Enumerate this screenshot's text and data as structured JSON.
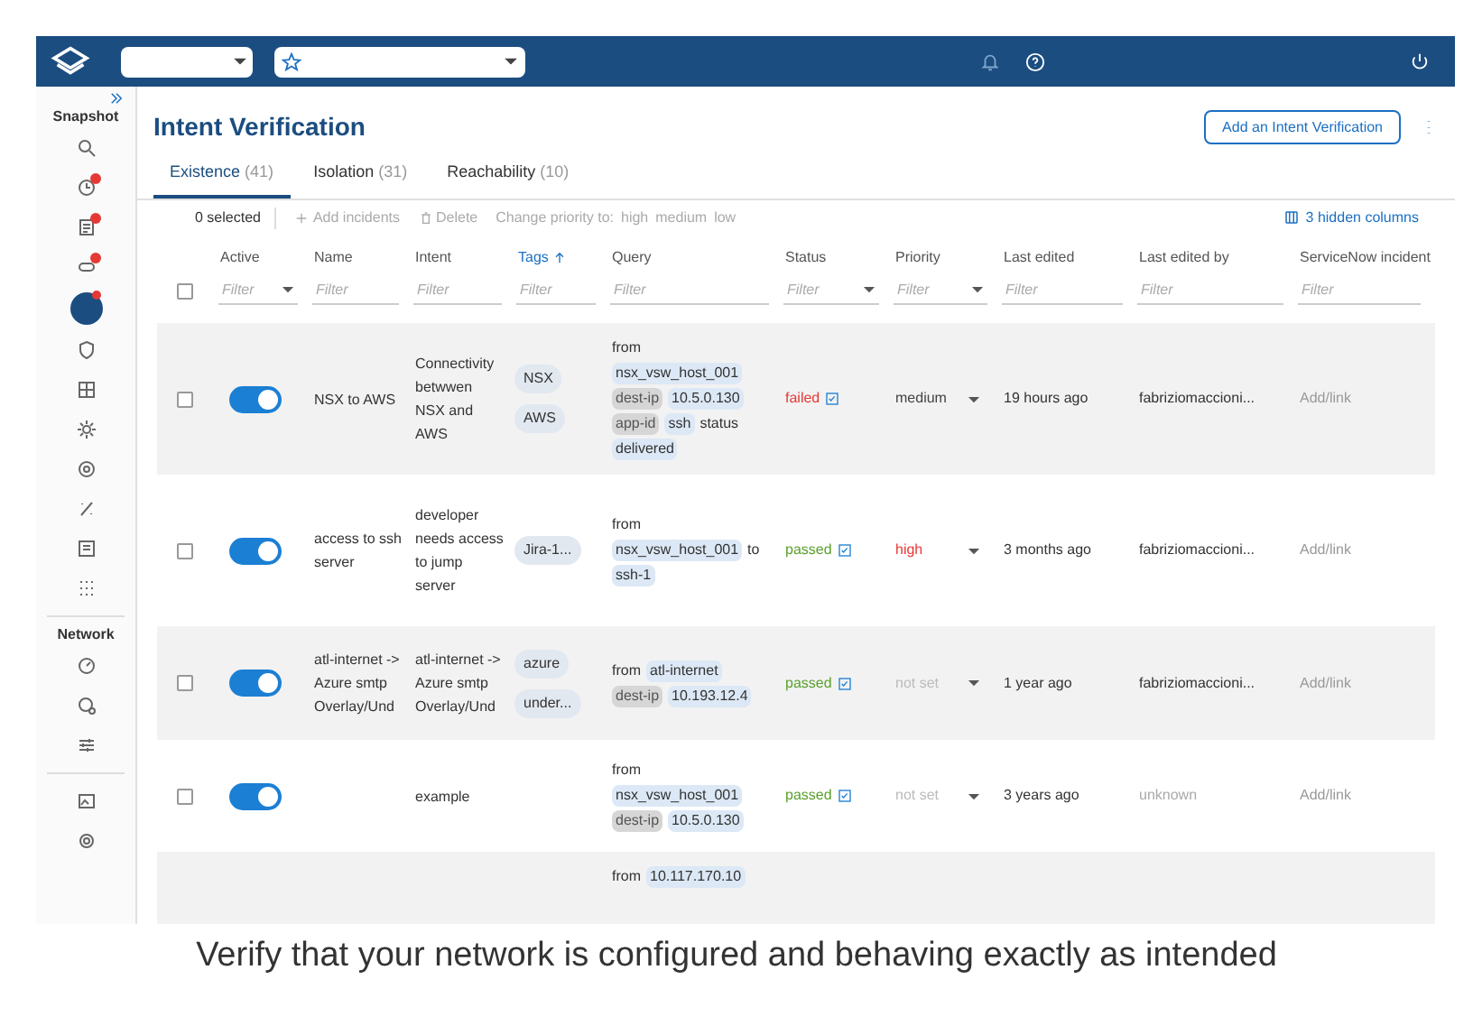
{
  "sidebar": {
    "sections": [
      {
        "label": "Snapshot"
      },
      {
        "label": "Network"
      }
    ]
  },
  "header": {
    "title": "Intent Verification",
    "add_button": "Add an Intent Verification"
  },
  "tabs": [
    {
      "label": "Existence",
      "count": "(41)",
      "selected": true
    },
    {
      "label": "Isolation",
      "count": "(31)",
      "selected": false
    },
    {
      "label": "Reachability",
      "count": "(10)",
      "selected": false
    }
  ],
  "toolbar": {
    "selected_count": "0 selected",
    "add_incidents": "Add incidents",
    "delete": "Delete",
    "change_priority": "Change priority to:",
    "priorities": [
      "high",
      "medium",
      "low"
    ],
    "hidden_columns": "3 hidden columns"
  },
  "table": {
    "select_all_checked": false,
    "columns": [
      {
        "label": "Active",
        "sorted": false,
        "filter": "Filter",
        "kind": "select"
      },
      {
        "label": "Name",
        "sorted": false,
        "filter": "Filter",
        "kind": "text"
      },
      {
        "label": "Intent",
        "sorted": false,
        "filter": "Filter",
        "kind": "text"
      },
      {
        "label": "Tags",
        "sorted": true,
        "filter": "Filter",
        "kind": "text"
      },
      {
        "label": "Query",
        "sorted": false,
        "filter": "Filter",
        "kind": "text"
      },
      {
        "label": "Status",
        "sorted": false,
        "filter": "Filter",
        "kind": "select"
      },
      {
        "label": "Priority",
        "sorted": false,
        "filter": "Filter",
        "kind": "select"
      },
      {
        "label": "Last edited",
        "sorted": false,
        "filter": "Filter",
        "kind": "text"
      },
      {
        "label": "Last edited by",
        "sorted": false,
        "filter": "Filter",
        "kind": "text"
      },
      {
        "label": "ServiceNow incident",
        "sorted": false,
        "filter": "Filter",
        "kind": "text"
      }
    ],
    "rows": [
      {
        "checked": false,
        "active": true,
        "name": "NSX to AWS",
        "intent": "Connectivity betwwen NSX and AWS",
        "tags": [
          "NSX",
          "AWS"
        ],
        "query": [
          {
            "kind": "text",
            "text": "from"
          },
          {
            "kind": "value",
            "text": "nsx_vsw_host_001"
          },
          {
            "kind": "key",
            "text": "dest-ip"
          },
          {
            "kind": "value",
            "text": "10.5.0.130"
          },
          {
            "kind": "key",
            "text": "app-id"
          },
          {
            "kind": "value",
            "text": "ssh"
          },
          {
            "kind": "text",
            "text": "status"
          },
          {
            "kind": "value",
            "text": "delivered"
          }
        ],
        "status": {
          "text": "failed",
          "kind": "failed"
        },
        "priority": {
          "text": "medium",
          "kind": "medium"
        },
        "last_edited": "19 hours ago",
        "last_edited_by": {
          "text": "fabriziomaccioni...",
          "known": true
        },
        "incident": "Add/link"
      },
      {
        "checked": false,
        "active": true,
        "name": "access to ssh server",
        "intent": "developer needs access to jump server",
        "tags": [
          "Jira-1..."
        ],
        "query": [
          {
            "kind": "text",
            "text": "from"
          },
          {
            "kind": "value",
            "text": "nsx_vsw_host_001"
          },
          {
            "kind": "text",
            "text": "to"
          },
          {
            "kind": "value",
            "text": "ssh-1"
          }
        ],
        "status": {
          "text": "passed",
          "kind": "passed"
        },
        "priority": {
          "text": "high",
          "kind": "high"
        },
        "last_edited": "3 months ago",
        "last_edited_by": {
          "text": "fabriziomaccioni...",
          "known": true
        },
        "incident": "Add/link"
      },
      {
        "checked": false,
        "active": true,
        "name": "atl-internet -> Azure smtp Overlay/Und",
        "intent": "atl-internet -> Azure smtp Overlay/Und",
        "tags": [
          "azure",
          "under..."
        ],
        "query": [
          {
            "kind": "text",
            "text": "from"
          },
          {
            "kind": "value",
            "text": "atl-internet"
          },
          {
            "kind": "key",
            "text": "dest-ip"
          },
          {
            "kind": "value",
            "text": "10.193.12.4"
          }
        ],
        "status": {
          "text": "passed",
          "kind": "passed"
        },
        "priority": {
          "text": "not set",
          "kind": "not_set"
        },
        "last_edited": "1 year ago",
        "last_edited_by": {
          "text": "fabriziomaccioni...",
          "known": true
        },
        "incident": "Add/link"
      },
      {
        "checked": false,
        "active": true,
        "name": "",
        "intent": "example",
        "tags": [],
        "query": [
          {
            "kind": "text",
            "text": "from"
          },
          {
            "kind": "value",
            "text": "nsx_vsw_host_001"
          },
          {
            "kind": "key",
            "text": "dest-ip"
          },
          {
            "kind": "value",
            "text": "10.5.0.130"
          }
        ],
        "status": {
          "text": "passed",
          "kind": "passed"
        },
        "priority": {
          "text": "not set",
          "kind": "not_set"
        },
        "last_edited": "3 years ago",
        "last_edited_by": {
          "text": "unknown",
          "known": false
        },
        "incident": "Add/link"
      },
      {
        "kind": "partial",
        "query": [
          {
            "kind": "text",
            "text": "from"
          },
          {
            "kind": "value",
            "text": "10.117.170.10"
          }
        ]
      }
    ]
  },
  "caption": "Verify that your network is configured and behaving exactly as intended"
}
